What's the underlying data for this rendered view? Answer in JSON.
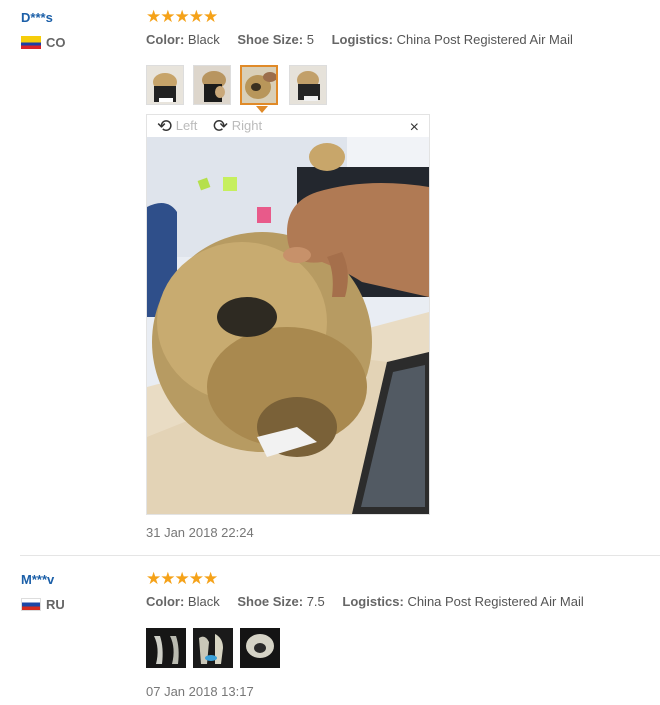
{
  "reviews": [
    {
      "user": "D***s",
      "country": "CO",
      "stars": "★★★★★",
      "color_label": "Color:",
      "color_value": "Black",
      "size_label": "Shoe Size:",
      "size_value": "5",
      "logistics_label": "Logistics:",
      "logistics_value": "China Post Registered Air Mail",
      "viewer": {
        "left_label": "Left",
        "right_label": "Right",
        "close": "×"
      },
      "date": "31 Jan 2018 22:24"
    },
    {
      "user": "M***v",
      "country": "RU",
      "stars": "★★★★★",
      "color_label": "Color:",
      "color_value": "Black",
      "size_label": "Shoe Size:",
      "size_value": "7.5",
      "logistics_label": "Logistics:",
      "logistics_value": "China Post Registered Air Mail",
      "date": "07 Jan 2018 13:17"
    }
  ],
  "colors": {
    "accent": "#f5a219",
    "username": "#1b5fa8",
    "selected_border": "#e08a28"
  }
}
